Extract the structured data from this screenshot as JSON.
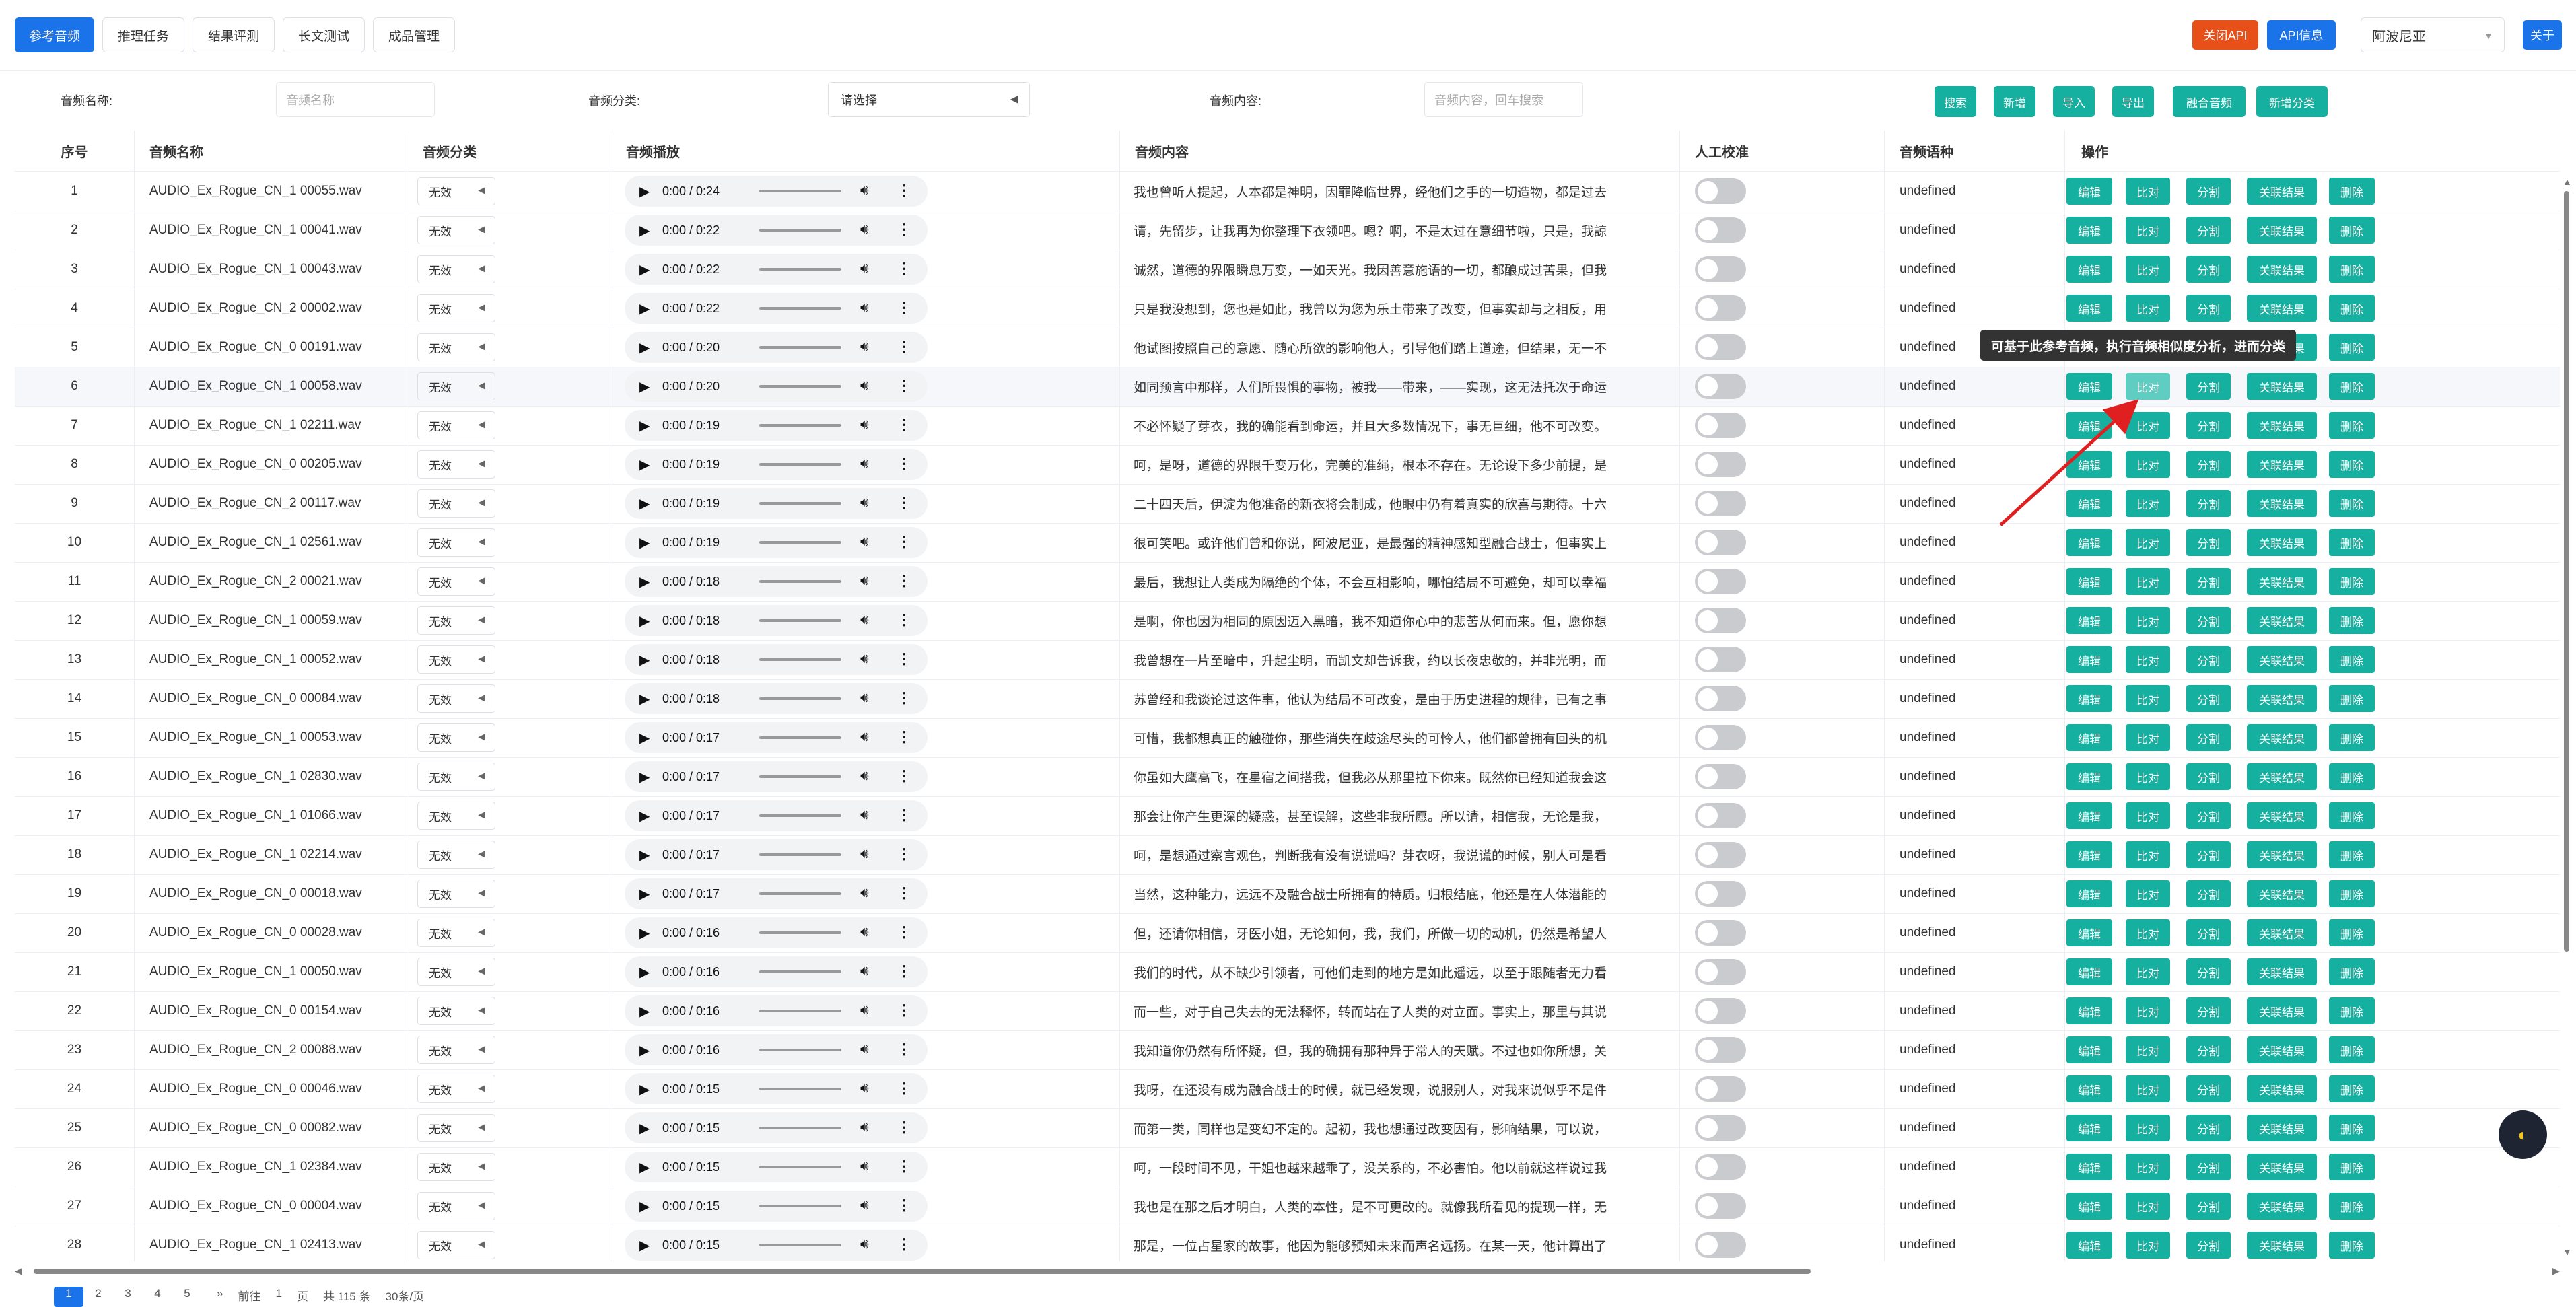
{
  "nav": {
    "tabs": [
      "参考音频",
      "推理任务",
      "结果评测",
      "长文测试",
      "成品管理"
    ],
    "close_api": "关闭API",
    "api_info": "API信息",
    "voice_select": "阿波尼亚",
    "about": "关于"
  },
  "search": {
    "name_label": "音频名称:",
    "name_placeholder": "音频名称",
    "category_label": "音频分类:",
    "category_placeholder": "请选择",
    "content_label": "音频内容:",
    "content_placeholder": "音频内容，回车搜索",
    "buttons": [
      "搜索",
      "新增",
      "导入",
      "导出",
      "融合音频",
      "新增分类"
    ]
  },
  "table": {
    "headers": [
      "序号",
      "音频名称",
      "音频分类",
      "音频播放",
      "音频内容",
      "人工校准",
      "音频语种",
      "操作"
    ],
    "op_labels": [
      "编辑",
      "比对",
      "分割",
      "关联结果",
      "删除"
    ],
    "category_value": "无效",
    "language_value": "undefined",
    "rows": [
      {
        "idx": "1",
        "name": "AUDIO_Ex_Rogue_CN_1 00055.wav",
        "time": "0:00 / 0:24",
        "content": "我也曾听人提起，人本都是神明，因罪降临世界，经他们之手的一切造物，都是过去"
      },
      {
        "idx": "2",
        "name": "AUDIO_Ex_Rogue_CN_1 00041.wav",
        "time": "0:00 / 0:22",
        "content": "请，先留步，让我再为你整理下衣领吧。嗯？啊，不是太过在意细节啦，只是，我諒"
      },
      {
        "idx": "3",
        "name": "AUDIO_Ex_Rogue_CN_1 00043.wav",
        "time": "0:00 / 0:22",
        "content": "诚然，道德的界限瞬息万变，一如天光。我因善意施语的一切，都酿成过苦果，但我"
      },
      {
        "idx": "4",
        "name": "AUDIO_Ex_Rogue_CN_2 00002.wav",
        "time": "0:00 / 0:22",
        "content": "只是我没想到，您也是如此，我曾以为您为乐土带来了改变，但事实却与之相反，用"
      },
      {
        "idx": "5",
        "name": "AUDIO_Ex_Rogue_CN_0 00191.wav",
        "time": "0:00 / 0:20",
        "content": "他试图按照自己的意愿、随心所欲的影响他人，引导他们踏上道途，但结果，无一不"
      },
      {
        "idx": "6",
        "name": "AUDIO_Ex_Rogue_CN_1 00058.wav",
        "time": "0:00 / 0:20",
        "content": "如同预言中那样，人们所畏惧的事物，被我——带来，——实现，这无法托次于命运"
      },
      {
        "idx": "7",
        "name": "AUDIO_Ex_Rogue_CN_1 02211.wav",
        "time": "0:00 / 0:19",
        "content": "不必怀疑了芽衣，我的确能看到命运，并且大多数情况下，事无巨细，他不可改变。"
      },
      {
        "idx": "8",
        "name": "AUDIO_Ex_Rogue_CN_0 00205.wav",
        "time": "0:00 / 0:19",
        "content": "呵，是呀，道德的界限千变万化，完美的准绳，根本不存在。无论设下多少前提，是"
      },
      {
        "idx": "9",
        "name": "AUDIO_Ex_Rogue_CN_2 00117.wav",
        "time": "0:00 / 0:19",
        "content": "二十四天后，伊淀为他准备的新衣将会制成，他眼中仍有着真实的欣喜与期待。十六"
      },
      {
        "idx": "10",
        "name": "AUDIO_Ex_Rogue_CN_1 02561.wav",
        "time": "0:00 / 0:19",
        "content": "很可笑吧。或许他们曾和你说，阿波尼亚，是最强的精神感知型融合战士，但事实上"
      },
      {
        "idx": "11",
        "name": "AUDIO_Ex_Rogue_CN_2 00021.wav",
        "time": "0:00 / 0:18",
        "content": "最后，我想让人类成为隔绝的个体，不会互相影响，哪怕结局不可避免，却可以幸福"
      },
      {
        "idx": "12",
        "name": "AUDIO_Ex_Rogue_CN_1 00059.wav",
        "time": "0:00 / 0:18",
        "content": "是啊，你也因为相同的原因迈入黑暗，我不知道你心中的悲苦从何而来。但，愿你想"
      },
      {
        "idx": "13",
        "name": "AUDIO_Ex_Rogue_CN_1 00052.wav",
        "time": "0:00 / 0:18",
        "content": "我曾想在一片至暗中，升起尘明，而凯文却告诉我，约以长夜忠敬的，并非光明，而"
      },
      {
        "idx": "14",
        "name": "AUDIO_Ex_Rogue_CN_0 00084.wav",
        "time": "0:00 / 0:18",
        "content": "苏曾经和我谈论过这件事，他认为结局不可改变，是由于历史进程的规律，已有之事"
      },
      {
        "idx": "15",
        "name": "AUDIO_Ex_Rogue_CN_1 00053.wav",
        "time": "0:00 / 0:17",
        "content": "可惜，我都想真正的触碰你，那些消失在歧途尽头的可怜人，他们都曾拥有回头的机"
      },
      {
        "idx": "16",
        "name": "AUDIO_Ex_Rogue_CN_1 02830.wav",
        "time": "0:00 / 0:17",
        "content": "你虽如大鹰高飞，在星宿之间搭我，但我必从那里拉下你来。既然你已经知道我会这"
      },
      {
        "idx": "17",
        "name": "AUDIO_Ex_Rogue_CN_1 01066.wav",
        "time": "0:00 / 0:17",
        "content": "那会让你产生更深的疑惑，甚至误解，这些非我所愿。所以请，相信我，无论是我，"
      },
      {
        "idx": "18",
        "name": "AUDIO_Ex_Rogue_CN_1 02214.wav",
        "time": "0:00 / 0:17",
        "content": "呵，是想通过察言观色，判断我有没有说谎吗？芽衣呀，我说谎的时候，别人可是看"
      },
      {
        "idx": "19",
        "name": "AUDIO_Ex_Rogue_CN_0 00018.wav",
        "time": "0:00 / 0:17",
        "content": "当然，这种能力，远远不及融合战士所拥有的特质。归根结底，他还是在人体潜能的"
      },
      {
        "idx": "20",
        "name": "AUDIO_Ex_Rogue_CN_0 00028.wav",
        "time": "0:00 / 0:16",
        "content": "但，还请你相信，牙医小姐，无论如何，我，我们，所做一切的动机，仍然是希望人"
      },
      {
        "idx": "21",
        "name": "AUDIO_Ex_Rogue_CN_1 00050.wav",
        "time": "0:00 / 0:16",
        "content": "我们的时代，从不缺少引领者，可他们走到的地方是如此遥远，以至于跟随者无力看"
      },
      {
        "idx": "22",
        "name": "AUDIO_Ex_Rogue_CN_0 00154.wav",
        "time": "0:00 / 0:16",
        "content": "而一些，对于自己失去的无法释怀，转而站在了人类的对立面。事实上，那里与其说"
      },
      {
        "idx": "23",
        "name": "AUDIO_Ex_Rogue_CN_2 00088.wav",
        "time": "0:00 / 0:16",
        "content": "我知道你仍然有所怀疑，但，我的确拥有那种异于常人的天赋。不过也如你所想，关"
      },
      {
        "idx": "24",
        "name": "AUDIO_Ex_Rogue_CN_0 00046.wav",
        "time": "0:00 / 0:15",
        "content": "我呀，在还没有成为融合战士的时候，就已经发现，说服别人，对我来说似乎不是件"
      },
      {
        "idx": "25",
        "name": "AUDIO_Ex_Rogue_CN_0 00082.wav",
        "time": "0:00 / 0:15",
        "content": "而第一类，同样也是变幻不定的。起初，我也想通过改变因有，影响结果，可以说，"
      },
      {
        "idx": "26",
        "name": "AUDIO_Ex_Rogue_CN_1 02384.wav",
        "time": "0:00 / 0:15",
        "content": "呵，一段时间不见，干姐也越来越乖了，没关系的，不必害怕。他以前就这样说过我"
      },
      {
        "idx": "27",
        "name": "AUDIO_Ex_Rogue_CN_0 00004.wav",
        "time": "0:00 / 0:15",
        "content": "我也是在那之后才明白，人类的本性，是不可更改的。就像我所看见的提现一样，无"
      },
      {
        "idx": "28",
        "name": "AUDIO_Ex_Rogue_CN_1 02413.wav",
        "time": "0:00 / 0:15",
        "content": "那是，一位占星家的故事，他因为能够预知未来而声名远扬。在某一天，他计算出了"
      }
    ]
  },
  "tooltip": "可基于此参考音频，执行音频相似度分析，进而分类",
  "pager": {
    "pages": [
      "1",
      "2",
      "3",
      "4",
      "5"
    ],
    "extras": [
      "»",
      "前往",
      "1",
      "页",
      "共 115 条",
      "30条/页"
    ]
  },
  "colors": {
    "primary": "#1a73e8",
    "teal": "#16b0a0",
    "danger": "#e8501a",
    "tooltip_bg": "#333333",
    "arrow": "#e02020"
  }
}
